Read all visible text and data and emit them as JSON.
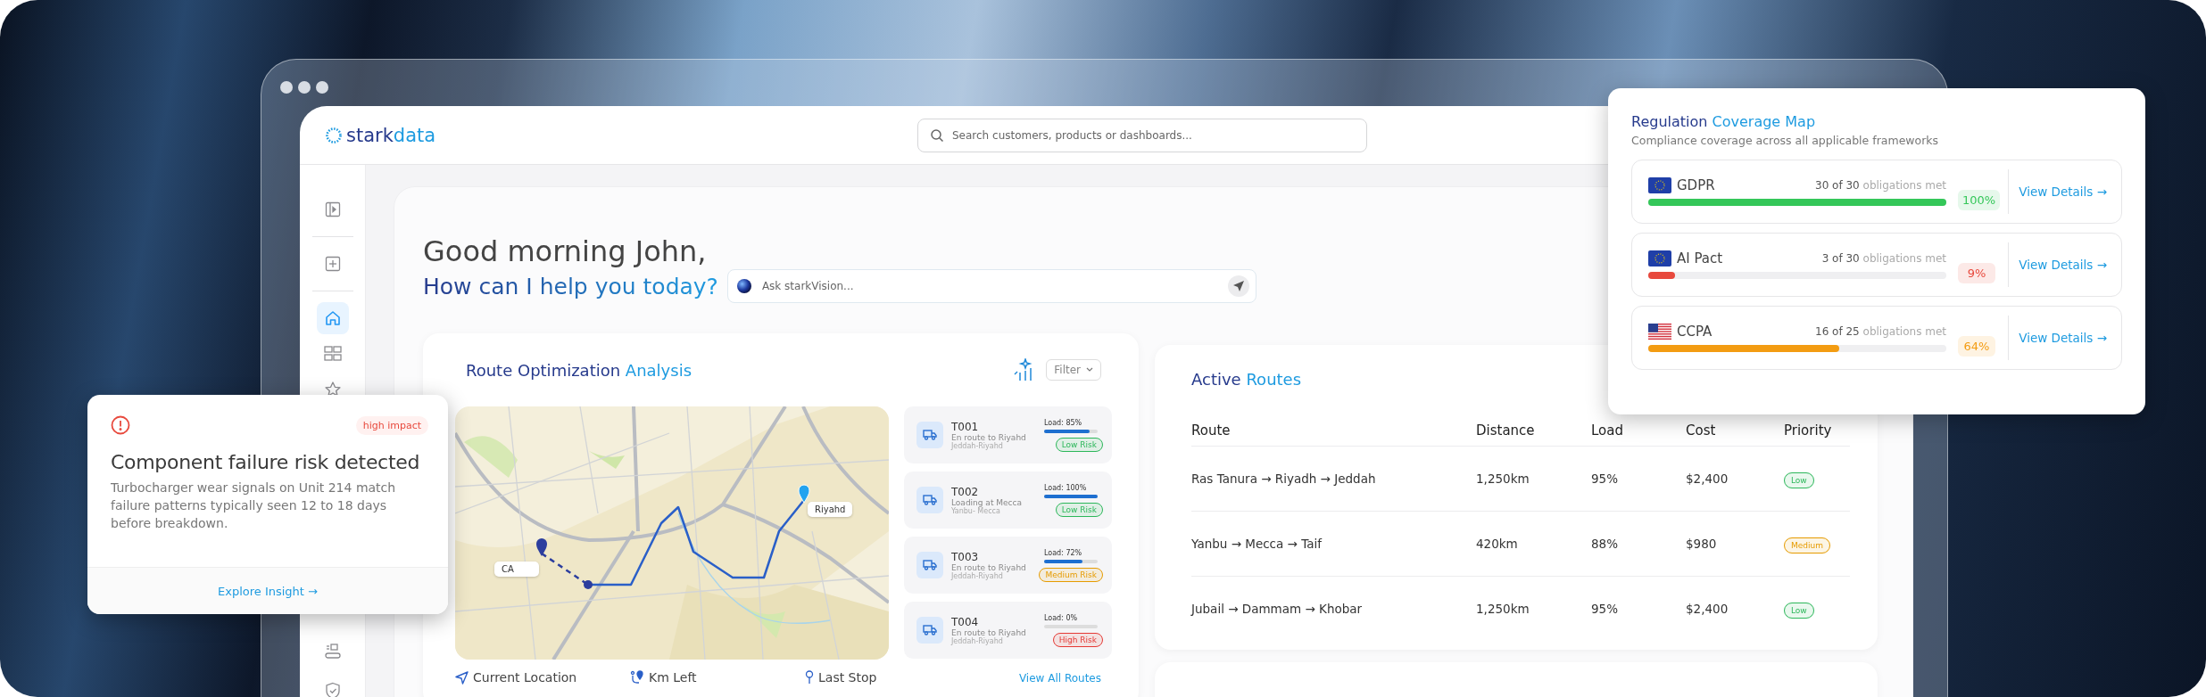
{
  "app": {
    "logo_lead": "stark",
    "logo_tail": "data",
    "search": {
      "placeholder": "Search customers, products or dashboards..."
    }
  },
  "sidebar": {
    "top_items": [
      {
        "selected": false
      },
      {
        "selected": false
      },
      {
        "selected": true
      },
      {
        "selected": false
      },
      {
        "selected": false
      }
    ],
    "bottom_items": [
      {
        "selected": false
      },
      {
        "selected": false
      }
    ]
  },
  "greeting": {
    "title": "Good morning John,",
    "subtitle": "How can I help you today?",
    "ask": {
      "placeholder": "Ask starkVision..."
    }
  },
  "route_panel": {
    "title_lead": "Route Optimization",
    "title_tail": "Analysis",
    "filter": "Filter",
    "map_labels": [
      "CA",
      "Riyahd"
    ],
    "trucks": [
      {
        "id": "T001",
        "status": "En route to Riyahd",
        "route": "Jeddah-Riyahd",
        "load": "Load: 85%",
        "level": 0.85,
        "risk": "Low Risk",
        "color": "#2cb75a"
      },
      {
        "id": "T002",
        "status": "Loading at Mecca",
        "route": "Yanbu- Mecca",
        "load": "Load: 100%",
        "level": 1,
        "risk": "Low Risk",
        "color": "#2cb75a"
      },
      {
        "id": "T003",
        "status": "En route to Riyahd",
        "route": "Jeddah-Riyahd",
        "load": "Load: 72%",
        "level": 0.72,
        "risk": "Medium Risk",
        "color": "#e69b00"
      },
      {
        "id": "T004",
        "status": "En route to Riyahd",
        "route": "Jeddah-Riyahd",
        "load": "Load: 0%",
        "level": 0,
        "risk": "High Risk",
        "color": "#e53935"
      }
    ],
    "legend": [
      "Current Location",
      "Km Left",
      "Last Stop"
    ],
    "link": "View All Routes"
  },
  "active_routes": {
    "title_lead": "Active",
    "title_tail": "Routes",
    "columns": [
      "Route",
      "Distance",
      "Load",
      "Cost",
      "Priority"
    ],
    "rows": [
      {
        "route": "Ras Tanura → Riyadh → Jeddah",
        "distance": "1,250km",
        "load": "95%",
        "cost": "$2,400",
        "priority": "Low",
        "color": "#2cb75a"
      },
      {
        "route": "Yanbu → Mecca → Taif",
        "distance": "420km",
        "load": "88%",
        "cost": "$980",
        "priority": "Medium",
        "color": "#e69b00"
      },
      {
        "route": "Jubail → Dammam → Khobar",
        "distance": "1,250km",
        "load": "95%",
        "cost": "$2,400",
        "priority": "Low",
        "color": "#2cb75a"
      }
    ]
  },
  "regulation": {
    "title_lead": "Regulation",
    "title_tail": "Coverage Map",
    "subtitle": "Compliance coverage across all applicable frameworks",
    "frameworks": [
      {
        "kind": "eu",
        "name": "GDPR",
        "count": "30 of 30",
        "count_note": "obligations met",
        "percent": "100%",
        "level": 1,
        "color": "#34c759",
        "link": "View Details →"
      },
      {
        "kind": "eu",
        "name": "AI Pact",
        "count": "3 of 30",
        "count_note": "obligations met",
        "percent": "9%",
        "level": 0.09,
        "color": "#e8493d",
        "link": "View Details →"
      },
      {
        "kind": "us",
        "name": "CCPA",
        "count": "16 of 25",
        "count_note": "obligations met",
        "percent": "64%",
        "level": 0.64,
        "color": "#f39c12",
        "link": "View Details →"
      }
    ]
  },
  "insight": {
    "badge": "high impact",
    "title": "Component failure risk detected",
    "body": "Turbocharger wear signals on Unit 214 match failure patterns typically seen 12 to 18 days before breakdown.",
    "link": "Explore Insight →"
  }
}
